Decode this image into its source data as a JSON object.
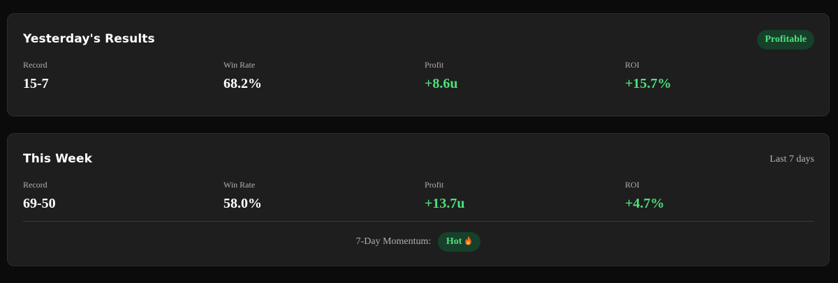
{
  "yesterday": {
    "title": "Yesterday's Results",
    "badge": "Profitable",
    "stats": [
      {
        "label": "Record",
        "value": "15-7"
      },
      {
        "label": "Win Rate",
        "value": "68.2%"
      },
      {
        "label": "Profit",
        "value": "+8.6u"
      },
      {
        "label": "ROI",
        "value": "+15.7%"
      }
    ]
  },
  "week": {
    "title": "This Week",
    "period": "Last 7 days",
    "stats": [
      {
        "label": "Record",
        "value": "69-50"
      },
      {
        "label": "Win Rate",
        "value": "58.0%"
      },
      {
        "label": "Profit",
        "value": "+13.7u"
      },
      {
        "label": "ROI",
        "value": "+4.7%"
      }
    ],
    "momentum": {
      "label": "7-Day Momentum:",
      "status": "Hot",
      "icon": "flame-icon"
    }
  },
  "colors": {
    "background": "#0b0b0b",
    "card": "#1e1e1e",
    "positive": "#4ee07a",
    "badge_bg": "#16402a"
  }
}
